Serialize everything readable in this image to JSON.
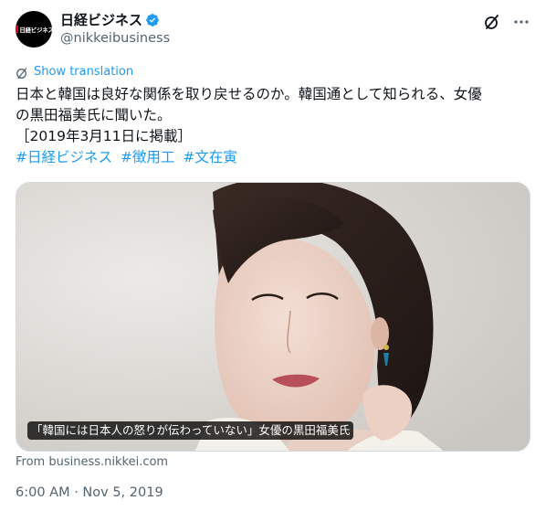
{
  "account": {
    "avatar_text": "日経ビジネス",
    "display_name": "日経ビジネス",
    "handle": "@nikkeibusiness",
    "verified": true
  },
  "header": {
    "grok_icon": "grok-slash-circle-icon",
    "more_icon": "more-dots-icon"
  },
  "translation": {
    "label": "Show translation",
    "icon": "translate-globe-icon"
  },
  "tweet": {
    "line1": "日本と韓国は良好な関係を取り戻せるのか。韓国通として知られる、女優",
    "line2": "の黒田福美氏に聞いた。",
    "line3": "［2019年3月11日に掲載］",
    "hashtags": [
      "#日経ビジネス",
      "#徴用工",
      "#文在寅"
    ]
  },
  "media": {
    "caption": "「韓国には日本人の怒りが伝わっていない」女優の黒田福美氏",
    "source": "From business.nikkei.com"
  },
  "timestamp": "6:00 AM · Nov 5, 2019",
  "colors": {
    "accent": "#1d9bf0",
    "text": "#0f1419",
    "secondary": "#536471",
    "brand_red": "#e60012"
  }
}
